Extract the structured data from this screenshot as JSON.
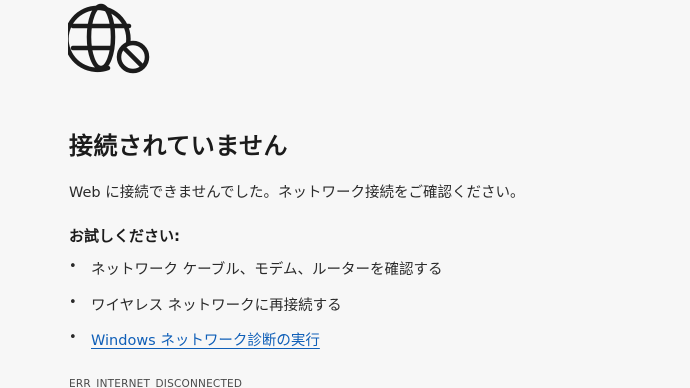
{
  "icon": {
    "name": "globe-blocked-icon"
  },
  "title": "接続されていません",
  "message": "Web に接続できませんでした。ネットワーク接続をご確認ください。",
  "try_heading": "お試しください:",
  "suggestions": [
    {
      "text": "ネットワーク ケーブル、モデム、ルーターを確認する",
      "link": false
    },
    {
      "text": "ワイヤレス ネットワークに再接続する",
      "link": false
    },
    {
      "text": "Windows ネットワーク診断の実行",
      "link": true
    }
  ],
  "error_code": "ERR_INTERNET_DISCONNECTED",
  "colors": {
    "background": "#f7f7f7",
    "text": "#1b1b1b",
    "link": "#0f5fb8"
  }
}
